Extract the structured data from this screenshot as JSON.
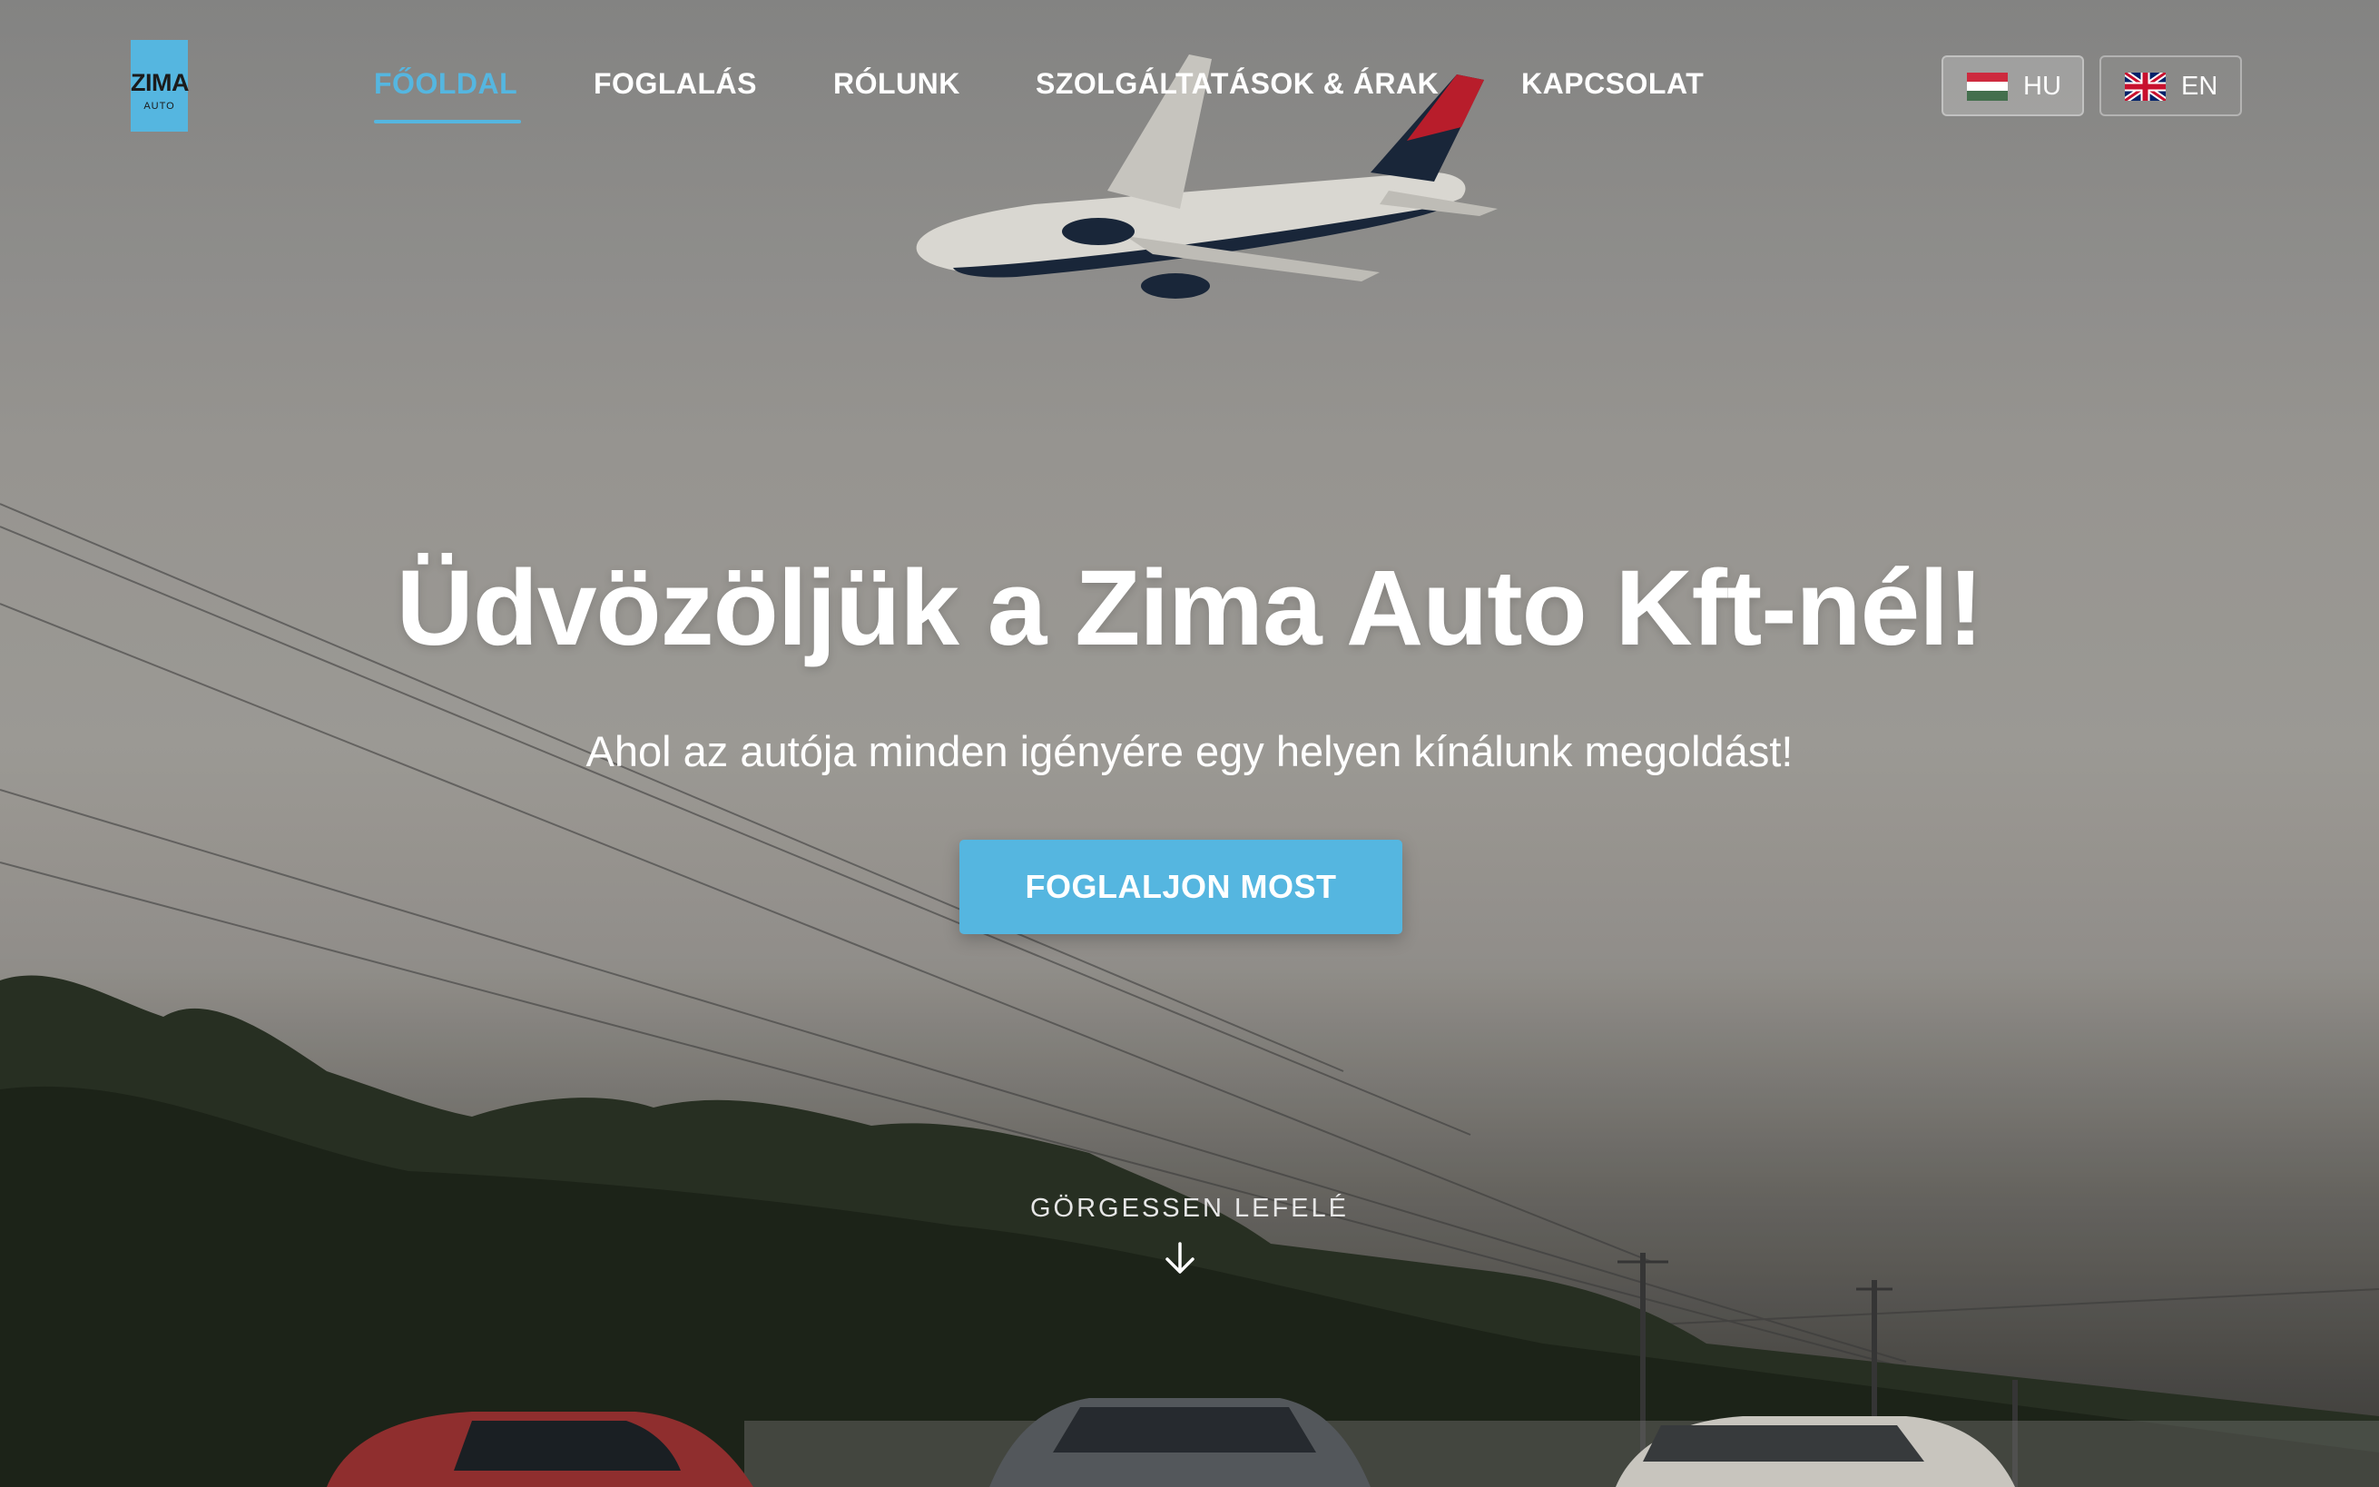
{
  "brand": {
    "name": "ZIMA",
    "sub": "AUTO"
  },
  "nav": {
    "items": [
      {
        "label": "FŐOLDAL",
        "active": true
      },
      {
        "label": "FOGLALÁS",
        "active": false
      },
      {
        "label": "RÓLUNK",
        "active": false
      },
      {
        "label": "SZOLGÁLTATÁSOK & ÁRAK",
        "active": false
      },
      {
        "label": "KAPCSOLAT",
        "active": false
      }
    ]
  },
  "languages": [
    {
      "code": "HU",
      "flag": "hungary-flag-icon",
      "selected": true
    },
    {
      "code": "EN",
      "flag": "uk-flag-icon",
      "selected": false
    }
  ],
  "hero": {
    "title": "Üdvözöljük a Zima Auto Kft-nél!",
    "subtitle": "Ahol az autója minden igényére egy helyen kínálunk megoldást!",
    "cta_label": "FOGLALJON MOST",
    "scroll_hint": "GÖRGESSEN LEFELÉ",
    "scroll_icon": "arrow-down-icon",
    "background": "airplane-over-parked-cars-photo"
  },
  "colors": {
    "accent": "#55b6e0",
    "text_on_hero": "#ffffff"
  }
}
